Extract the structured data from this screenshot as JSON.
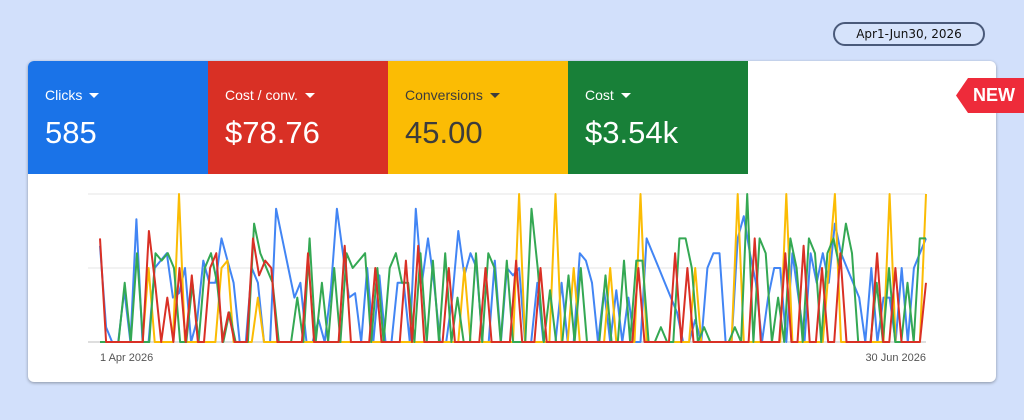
{
  "date_range": "Apr1-Jun30, 2026",
  "badge": "NEW",
  "metrics": [
    {
      "label": "Clicks",
      "value": "585",
      "bg": "#1a73e8",
      "fg": "#ffffff"
    },
    {
      "label": "Cost / conv.",
      "value": "$78.76",
      "bg": "#d93025",
      "fg": "#ffffff"
    },
    {
      "label": "Conversions",
      "value": "45.00",
      "bg": "#fbbc04",
      "fg": "#3c3c3c"
    },
    {
      "label": "Cost",
      "value": "$3.54k",
      "bg": "#188038",
      "fg": "#ffffff"
    }
  ],
  "chart_data": {
    "type": "line",
    "x_ticks": [
      "1 Apr 2026",
      "30 Jun 2026"
    ],
    "ylim": [
      0,
      1
    ],
    "grid": true,
    "series": [
      {
        "color": "#4285f4",
        "values": [
          0.65,
          0.1,
          0.0,
          0.0,
          0.35,
          0.0,
          0.83,
          0.0,
          0.0,
          0.5,
          0.55,
          0.6,
          0.3,
          0.33,
          0.5,
          0.0,
          0.15,
          0.55,
          0.4,
          0.4,
          0.7,
          0.55,
          0.4,
          0.0,
          0.0,
          0.5,
          0.4,
          0.0,
          0.0,
          0.9,
          0.7,
          0.5,
          0.3,
          0.4,
          0.0,
          0.0,
          0.15,
          0.0,
          0.35,
          0.9,
          0.6,
          0.3,
          0.33,
          0.0,
          0.5,
          0.0,
          0.45,
          0.0,
          0.0,
          0.4,
          0.4,
          0.0,
          0.9,
          0.4,
          0.7,
          0.4,
          0.0,
          0.0,
          0.3,
          0.75,
          0.45,
          0.6,
          0.5,
          0.0,
          0.0,
          0.55,
          0.0,
          0.5,
          0.45,
          0.5,
          0.0,
          0.0,
          0.4,
          0.0,
          0.0,
          0.0,
          0.4,
          0.0,
          0.0,
          0.6,
          0.55,
          0.4,
          0.0,
          0.35,
          0.0,
          0.35,
          0.0,
          0.3,
          0.0,
          0.0,
          0.7,
          0.6,
          0.5,
          0.4,
          0.3,
          0.2,
          0.0,
          0.0,
          0.15,
          0.0,
          0.5,
          0.6,
          0.6,
          0.0,
          0.0,
          0.7,
          0.85,
          0.6,
          0.4,
          0.0,
          0.3,
          0.5,
          0.5,
          0.0,
          0.6,
          0.3,
          0.0,
          0.6,
          0.4,
          0.6,
          0.4,
          0.8,
          0.6,
          0.5,
          0.4,
          0.3,
          0.0,
          0.5,
          0.0,
          0.3,
          0.3,
          0.0,
          0.5,
          0.0,
          0.5,
          0.6,
          0.7
        ]
      },
      {
        "color": "#fbbc04",
        "values": [
          0.0,
          0.0,
          0.0,
          0.0,
          0.0,
          0.0,
          0.0,
          0.0,
          0.5,
          0.0,
          0.0,
          0.0,
          0.0,
          1.0,
          0.0,
          0.0,
          0.0,
          0.0,
          0.0,
          0.0,
          0.5,
          0.55,
          0.0,
          0.0,
          0.0,
          0.0,
          0.3,
          0.0,
          0.0,
          0.0,
          0.0,
          0.0,
          0.0,
          0.0,
          0.0,
          0.0,
          0.0,
          0.0,
          0.0,
          0.0,
          0.0,
          0.0,
          0.0,
          0.0,
          0.0,
          0.0,
          0.0,
          0.0,
          0.0,
          0.0,
          0.0,
          0.0,
          0.0,
          0.0,
          0.0,
          0.0,
          0.0,
          0.0,
          0.0,
          0.0,
          0.5,
          0.0,
          0.0,
          0.0,
          0.0,
          0.0,
          0.0,
          0.0,
          0.0,
          1.0,
          0.0,
          0.0,
          0.0,
          0.0,
          0.0,
          1.0,
          0.0,
          0.0,
          0.5,
          0.0,
          0.0,
          0.0,
          0.0,
          0.0,
          0.5,
          0.0,
          0.0,
          0.0,
          0.0,
          1.0,
          0.0,
          0.0,
          0.0,
          0.0,
          0.0,
          0.0,
          0.0,
          0.0,
          0.5,
          0.0,
          0.0,
          0.0,
          0.0,
          0.0,
          0.0,
          1.0,
          0.0,
          0.0,
          0.0,
          0.0,
          0.0,
          0.0,
          0.0,
          1.0,
          0.0,
          0.0,
          0.0,
          0.0,
          0.0,
          0.0,
          0.5,
          1.0,
          0.0,
          0.0,
          0.0,
          0.0,
          0.0,
          0.0,
          0.0,
          0.0,
          1.0,
          0.0,
          0.0,
          0.0,
          0.0,
          0.0,
          1.0
        ]
      },
      {
        "color": "#34a853",
        "values": [
          0.0,
          0.0,
          0.0,
          0.0,
          0.4,
          0.0,
          0.6,
          0.0,
          0.0,
          0.6,
          0.55,
          0.6,
          0.5,
          0.0,
          0.0,
          0.4,
          0.0,
          0.5,
          0.6,
          0.4,
          0.0,
          0.2,
          0.0,
          0.0,
          0.0,
          0.8,
          0.6,
          0.5,
          0.4,
          0.0,
          0.0,
          0.0,
          0.3,
          0.0,
          0.7,
          0.0,
          0.4,
          0.0,
          0.5,
          0.0,
          0.6,
          0.5,
          0.55,
          0.6,
          0.0,
          0.5,
          0.0,
          0.5,
          0.6,
          0.4,
          0.4,
          0.0,
          0.6,
          0.0,
          0.55,
          0.0,
          0.6,
          0.0,
          0.3,
          0.0,
          0.0,
          0.6,
          0.0,
          0.6,
          0.5,
          0.0,
          0.55,
          0.0,
          0.0,
          0.0,
          0.9,
          0.5,
          0.0,
          0.35,
          0.0,
          0.0,
          0.45,
          0.0,
          0.5,
          0.0,
          0.0,
          0.0,
          0.45,
          0.0,
          0.0,
          0.55,
          0.0,
          0.55,
          0.55,
          0.0,
          0.0,
          0.1,
          0.0,
          0.0,
          0.7,
          0.7,
          0.5,
          0.0,
          0.1,
          0.0,
          0.0,
          0.0,
          0.0,
          0.1,
          0.0,
          1.0,
          0.0,
          0.7,
          0.6,
          0.0,
          0.3,
          0.0,
          0.7,
          0.5,
          0.0,
          0.7,
          0.6,
          0.0,
          0.6,
          0.7,
          0.5,
          0.8,
          0.6,
          0.0,
          0.0,
          0.0,
          0.4,
          0.0,
          0.5,
          0.0,
          0.0,
          0.4,
          0.0,
          0.7,
          0.7
        ]
      },
      {
        "color": "#d93025",
        "values": [
          0.7,
          0.0,
          0.0,
          0.0,
          0.0,
          0.0,
          0.0,
          0.0,
          0.75,
          0.4,
          0.0,
          0.3,
          0.0,
          0.5,
          0.0,
          0.45,
          0.0,
          0.0,
          0.5,
          0.6,
          0.0,
          0.2,
          0.0,
          0.0,
          0.0,
          0.7,
          0.45,
          0.55,
          0.5,
          0.0,
          0.0,
          0.0,
          0.0,
          0.0,
          0.6,
          0.0,
          0.0,
          0.0,
          0.0,
          0.0,
          0.65,
          0.0,
          0.0,
          0.0,
          0.0,
          0.5,
          0.0,
          0.0,
          0.0,
          0.0,
          0.55,
          0.0,
          0.65,
          0.0,
          0.0,
          0.0,
          0.0,
          0.5,
          0.0,
          0.0,
          0.0,
          0.0,
          0.0,
          0.5,
          0.0,
          0.0,
          0.0,
          0.0,
          0.55,
          0.0,
          0.0,
          0.0,
          0.5,
          0.0,
          0.0,
          0.0,
          0.0,
          0.0,
          0.0,
          0.0,
          0.0,
          0.0,
          0.0,
          0.0,
          0.0,
          0.0,
          0.0,
          0.0,
          0.5,
          0.0,
          0.0,
          0.0,
          0.0,
          0.0,
          0.6,
          0.0,
          0.5,
          0.0,
          0.0,
          0.0,
          0.0,
          0.0,
          0.0,
          0.0,
          0.0,
          0.0,
          0.0,
          0.7,
          0.0,
          0.0,
          0.0,
          0.0,
          0.6,
          0.0,
          0.0,
          0.65,
          0.0,
          0.0,
          0.5,
          0.0,
          0.0,
          0.6,
          0.0,
          0.0,
          0.0,
          0.0,
          0.0,
          0.6,
          0.0,
          0.0,
          0.5,
          0.0,
          0.0,
          0.0,
          0.0,
          0.4
        ]
      }
    ]
  }
}
